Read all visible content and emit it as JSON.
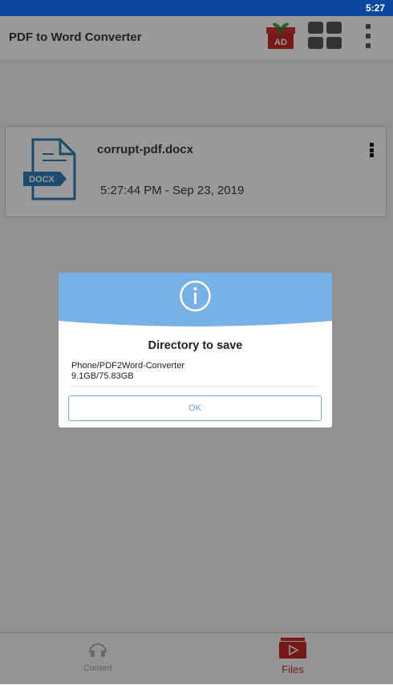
{
  "status_bar": {
    "time": "5:27"
  },
  "app_bar": {
    "title": "PDF to Word Converter",
    "ad_label": "AD"
  },
  "files": [
    {
      "name": "corrupt-pdf.docx",
      "date": "5:27:44 PM - Sep 23, 2019",
      "icon_label": "DOCX"
    }
  ],
  "bottom_nav": {
    "convert_label": "Convert",
    "files_label": "Files"
  },
  "dialog": {
    "title": "Directory to save",
    "path": "Phone/PDF2Word-Converter",
    "storage": "9.1GB/75.83GB",
    "ok_label": "OK"
  },
  "colors": {
    "status_bar": "#0d47a1",
    "accent_red": "#c62828",
    "dialog_header": "#78b1e6",
    "docx_blue": "#2a7fb8"
  }
}
